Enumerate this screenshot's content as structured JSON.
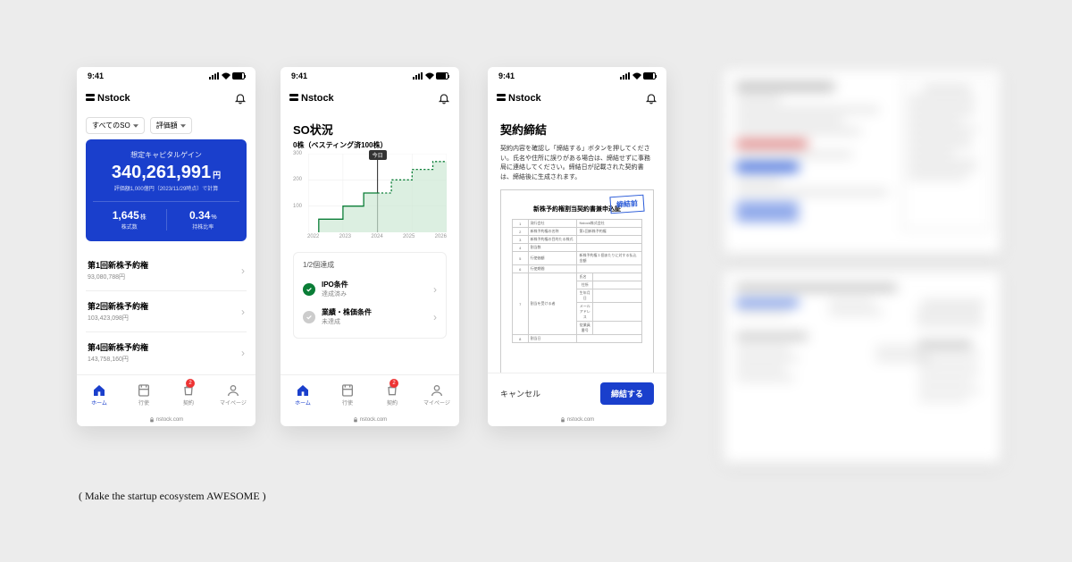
{
  "status_time": "9:41",
  "brand": "Nstock",
  "url": "nstock.com",
  "tagline": "( Make the startup ecosystem AWESOME )",
  "tabs": {
    "home": "ホーム",
    "exercise": "行使",
    "contract": "契約",
    "mypage": "マイページ",
    "badge": "2"
  },
  "p1": {
    "filter_so": "すべてのSO",
    "filter_val": "評価額",
    "gain_label": "想定キャピタルゲイン",
    "gain_amount": "340,261,991",
    "gain_unit": "円",
    "gain_note": "評価額1,000億円（2023/11/29時点）で計算",
    "shares_v": "1,645",
    "shares_u": "株",
    "shares_sub": "株式数",
    "ratio_v": "0.34",
    "ratio_u": "%",
    "ratio_sub": "持株比率",
    "rows": [
      {
        "t": "第1回新株予約権",
        "s": "93,080,788円"
      },
      {
        "t": "第2回新株予約権",
        "s": "103,423,098円"
      },
      {
        "t": "第4回新株予約権",
        "s": "143,758,160円"
      }
    ]
  },
  "p2": {
    "title": "SO状況",
    "subtitle": "0株（ベスティング済100株）",
    "today": "今日",
    "chart_data": {
      "type": "area",
      "x": [
        2022,
        2023,
        2024,
        2025,
        2026
      ],
      "y_ticks": [
        100,
        200,
        300
      ],
      "today_x": 2024,
      "ylim": [
        0,
        300
      ],
      "series": [
        {
          "name": "solid",
          "points": [
            {
              "x": 2022.3,
              "y": 0
            },
            {
              "x": 2022.3,
              "y": 50
            },
            {
              "x": 2023.0,
              "y": 50
            },
            {
              "x": 2023.0,
              "y": 100
            },
            {
              "x": 2023.6,
              "y": 100
            },
            {
              "x": 2023.6,
              "y": 150
            },
            {
              "x": 2024.0,
              "y": 150
            }
          ]
        },
        {
          "name": "dashed",
          "points": [
            {
              "x": 2024.0,
              "y": 150
            },
            {
              "x": 2024.4,
              "y": 150
            },
            {
              "x": 2024.4,
              "y": 200
            },
            {
              "x": 2025.0,
              "y": 200
            },
            {
              "x": 2025.0,
              "y": 240
            },
            {
              "x": 2025.6,
              "y": 240
            },
            {
              "x": 2025.6,
              "y": 270
            },
            {
              "x": 2026.0,
              "y": 270
            }
          ]
        }
      ]
    },
    "milestone_head": "1/2個達成",
    "ms1_t": "IPO条件",
    "ms1_s": "達成済み",
    "ms2_t": "業績・株価条件",
    "ms2_s": "未達成"
  },
  "p3": {
    "title": "契約締結",
    "body": "契約内容を確認し「締結する」ボタンを押してください。氏名や住所に誤りがある場合は、締結せずに事務局に連絡してください。締結日が記載された契約書は、締結後に生成されます。",
    "stamp": "締結前",
    "doc_title": "新株予約権割当契約書兼申込証",
    "cancel": "キャンセル",
    "submit": "締結する"
  }
}
